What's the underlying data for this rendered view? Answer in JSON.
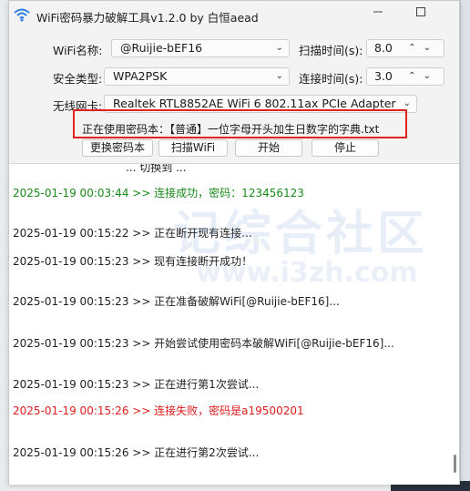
{
  "window": {
    "title": "WiFi密码暴力破解工具v1.2.0 by 白恒aead",
    "minimize_icon": "minimize-icon",
    "maximize_icon": "maximize-icon"
  },
  "form": {
    "wifi_name_label": "WiFi名称:",
    "wifi_name_value": "@Ruijie-bEF16",
    "security_label": "安全类型:",
    "security_value": "WPA2PSK",
    "adapter_label": "无线网卡:",
    "adapter_value": "Realtek RTL8852AE WiFi 6 802.11ax PCIe Adapter",
    "scan_time_label": "扫描时间(s):",
    "scan_time_value": "8.0",
    "connect_time_label": "连接时间(s):",
    "connect_time_value": "3.0",
    "dict_status": "正在使用密码本：【普通】一位字母开头加生日数字的字典.txt"
  },
  "buttons": {
    "change_dict": "更换密码本",
    "scan_wifi": "扫描WiFi",
    "start": "开始",
    "stop": "停止"
  },
  "log": {
    "cut_line": "... 切换到 ...",
    "lines": [
      "2025-01-19 00:03:44 >> 连接成功，密码：123456123",
      "2025-01-19 00:15:22 >> 正在断开现有连接...",
      "2025-01-19 00:15:23 >> 现有连接断开成功！",
      "2025-01-19 00:15:23 >> 正在准备破解WiFi[@Ruijie-bEF16]...",
      "2025-01-19 00:15:23 >> 开始尝试使用密码本破解WiFi[@Ruijie-bEF16]...",
      "2025-01-19 00:15:23 >> 正在进行第1次尝试...",
      "2025-01-19 00:15:26 >> 连接失败，密码是a19500201",
      "2025-01-19 00:15:26 >> 正在进行第2次尝试..."
    ]
  },
  "watermark": {
    "text": "记综合社区",
    "url": "www.i3zh.com"
  },
  "colors": {
    "success": "#1a8a1a",
    "error": "#e01b1b",
    "highlight_border": "#e0231c"
  }
}
